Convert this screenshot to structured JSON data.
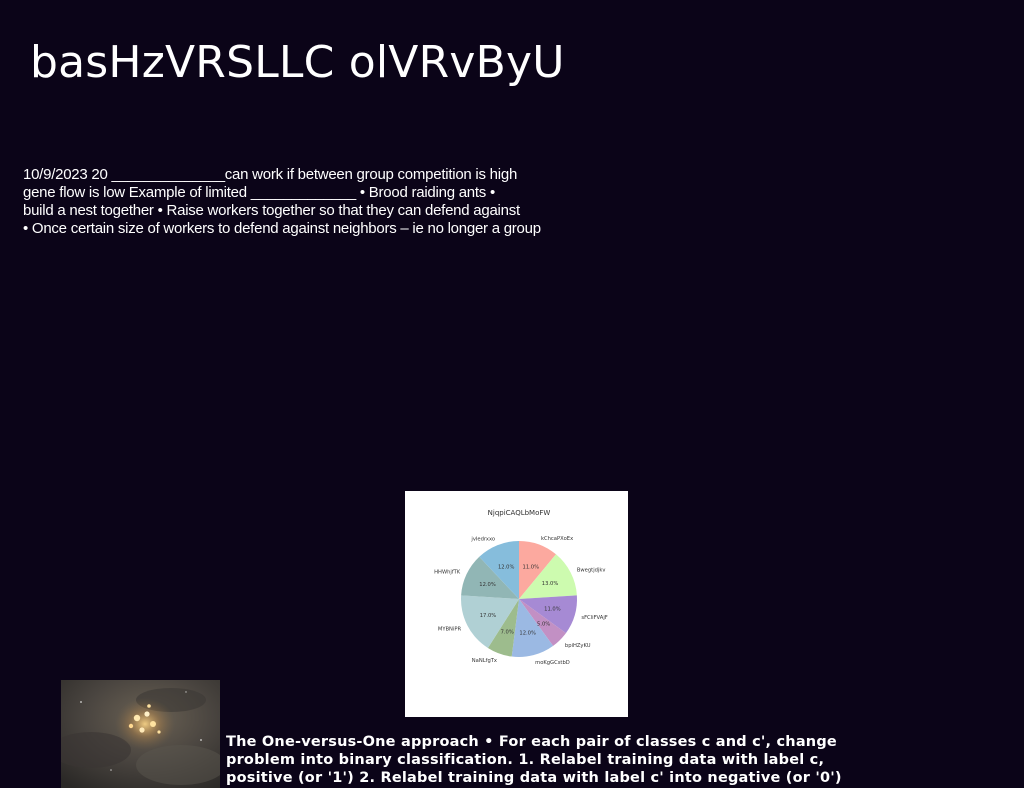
{
  "slide": {
    "title": "basHzVRSLLC olVRvByU",
    "body_lines": [
      "10/9/2023 20 ______________can work if between group competition is high",
      "gene flow is low Example of limited _____________ • Brood raiding ants •",
      "build a nest together • Raise workers together so that they can defend against",
      "• Once certain size of workers to defend against neighbors – ie no longer a group"
    ],
    "caption_lines": [
      "The One-versus-One approach • For each pair of classes c and c', change",
      "problem into binary classification. 1. Relabel training data with label c,",
      "positive (or '1') 2. Relabel training data with label c' into negative (or '0')"
    ]
  },
  "chart_data": {
    "type": "pie",
    "title": "NjqpiCAQLbMoFW",
    "categories": [
      "kChcaPXoEx",
      "Bwegtjdjkv",
      "sFCliFVAjF",
      "bpiHZyKU",
      "moKgGCstbD",
      "NaNLfgTx",
      "MYBNiPR",
      "HHWhjfTK",
      "jvIedrxxo"
    ],
    "values": [
      11.0,
      13.0,
      11.0,
      5.0,
      12.0,
      7.0,
      17.0,
      12.0,
      12.0
    ],
    "value_labels": [
      "11.0%",
      "13.0%",
      "11.0%",
      "5.0%",
      "12.0%",
      "7.0%",
      "17.0%",
      "12.0%",
      "12.0%"
    ],
    "colors": [
      "#fca99f",
      "#cdfbaf",
      "#a68ad4",
      "#c290c4",
      "#9bb9e3",
      "#9dbc8d",
      "#b0d0d4",
      "#91b6b5",
      "#86bddc"
    ],
    "start_angle_deg": 90,
    "direction": "clockwise",
    "legend": "none"
  }
}
